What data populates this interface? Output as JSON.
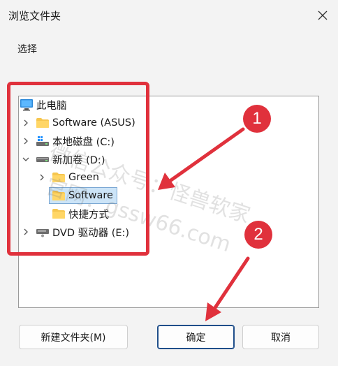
{
  "window": {
    "title": "浏览文件夹"
  },
  "prompt": "选择",
  "tree": {
    "root": {
      "label": "此电脑",
      "icon": "computer-icon"
    },
    "items": [
      {
        "label": "Software (ASUS)",
        "icon": "folder-icon"
      },
      {
        "label": "本地磁盘 (C:)",
        "icon": "drive-icon"
      },
      {
        "label": "新加卷 (D:)",
        "icon": "drive-icon",
        "expanded": true
      },
      {
        "label": "Green",
        "icon": "folder-icon"
      },
      {
        "label": "Software",
        "icon": "folder-icon",
        "selected": true
      },
      {
        "label": "快捷方式",
        "icon": "folder-icon"
      },
      {
        "label": "DVD 驱动器 (E:)",
        "icon": "dvd-drive-icon"
      }
    ]
  },
  "annotations": {
    "badge1": "1",
    "badge2": "2"
  },
  "watermark": {
    "line1": "微信公众号：怪兽软家",
    "line2": "官网：gssw66.com"
  },
  "buttons": {
    "new_folder": "新建文件夹(M)",
    "ok": "确定",
    "cancel": "取消"
  },
  "colors": {
    "annotation_red": "#e0313c",
    "selection_blue": "#cce4f7",
    "folder_yellow": "#f6c64f"
  }
}
